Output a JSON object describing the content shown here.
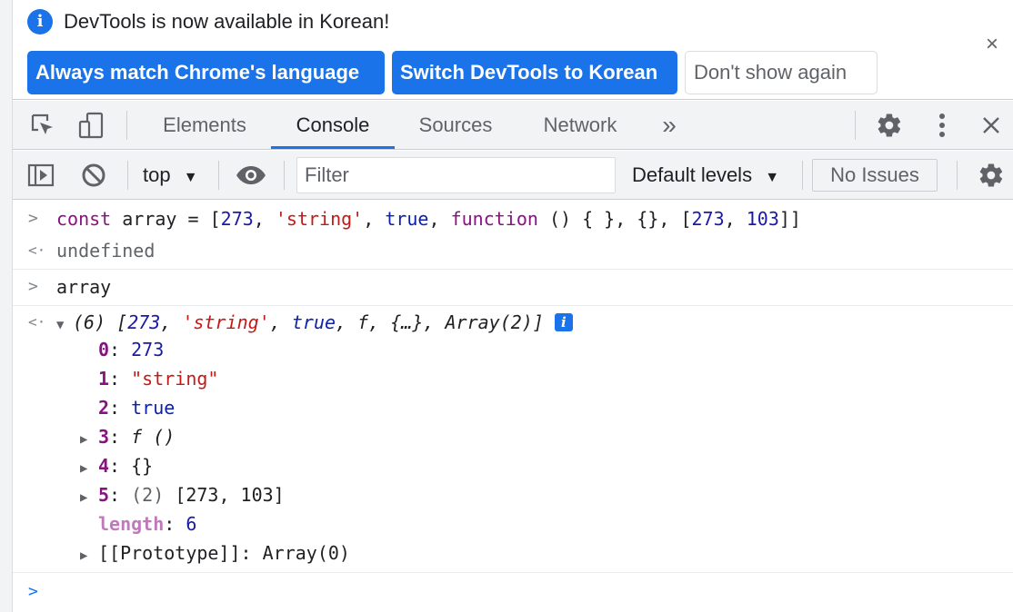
{
  "infobar": {
    "message": "DevTools is now available in Korean!",
    "info_icon": "i",
    "close": "×",
    "buttons": {
      "match": "Always match Chrome's language",
      "switch": "Switch DevTools to Korean",
      "dismiss": "Don't show again"
    }
  },
  "tabs": {
    "elements": "Elements",
    "console": "Console",
    "sources": "Sources",
    "network": "Network",
    "more": "»"
  },
  "toolbar": {
    "context": "top",
    "filter_placeholder": "Filter",
    "levels": "Default levels",
    "issues": "No Issues"
  },
  "console": {
    "cmd1": {
      "const": "const",
      "name": "array",
      "eq": "=",
      "n1": "273",
      "s1": "'string'",
      "b1": "true",
      "fn": "function",
      "fn_tail": "() { }",
      "obj": "{}",
      "n2": "273",
      "n3": "103"
    },
    "result1": "undefined",
    "cmd2": "array",
    "summary": {
      "count": "(6)",
      "n1": "273",
      "s1": "'string'",
      "b1": "true",
      "f": "f",
      "obj": "{…}",
      "arr": "Array(2)",
      "badge": "i"
    },
    "props": [
      {
        "key": "0",
        "value": "273"
      },
      {
        "key": "1",
        "value": "\"string\""
      },
      {
        "key": "2",
        "value": "true"
      },
      {
        "key": "3",
        "value": "f ()"
      },
      {
        "key": "4",
        "value": "{}"
      },
      {
        "key": "5",
        "count": "(2)",
        "value": "[273, 103]"
      },
      {
        "key": "length",
        "value": "6"
      },
      {
        "key": "[[Prototype]]",
        "value": "Array(0)"
      }
    ]
  }
}
